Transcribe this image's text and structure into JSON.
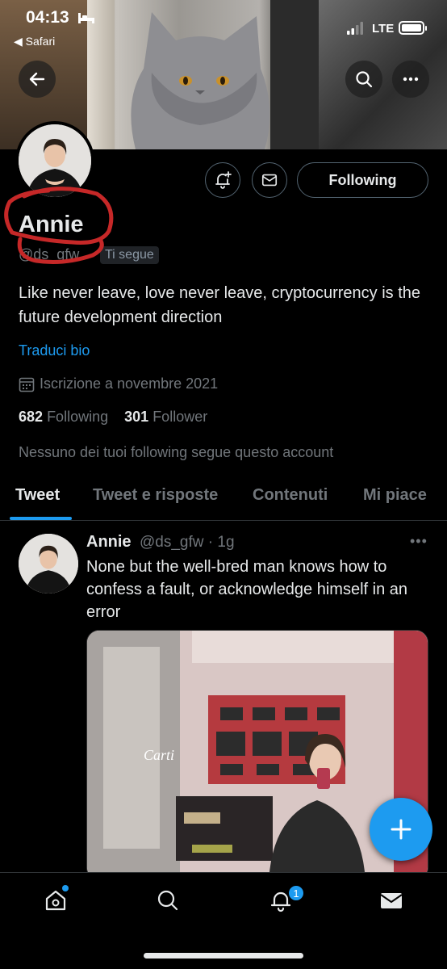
{
  "status_bar": {
    "time": "04:13",
    "back_app": "◀ Safari",
    "network": "LTE"
  },
  "profile": {
    "name": "Annie",
    "handle": "@ds_gfw",
    "follows_you": "Ti segue",
    "follow_button": "Following",
    "bio": "Like never leave, love never leave, cryptocurrency is the future development direction",
    "translate_bio": "Traduci bio",
    "joined": "Iscrizione a novembre 2021",
    "following_count": "682",
    "following_label": "Following",
    "follower_count": "301",
    "follower_label": "Follower",
    "mutuals": "Nessuno dei tuoi following segue questo account"
  },
  "tabs": [
    "Tweet",
    "Tweet e risposte",
    "Contenuti",
    "Mi piace"
  ],
  "active_tab": "Tweet",
  "tweet": {
    "name": "Annie",
    "handle_time": "@ds_gfw · 1g",
    "more": "•••",
    "text": "None but the well-bred man knows how to confess a fault, or acknowledge himself in an error",
    "media_store_sign": "Carti"
  },
  "bottom_nav": {
    "notifications_badge": "1"
  },
  "colors": {
    "accent": "#1d9bf0",
    "background": "#000000",
    "text": "#e7e9ea",
    "muted": "#71767b",
    "annotation": "#d32f2f"
  },
  "icons": [
    "back-arrow-icon",
    "search-icon",
    "more-icon",
    "bell-plus-icon",
    "mail-icon",
    "calendar-icon",
    "home-icon",
    "notifications-icon",
    "messages-icon",
    "compose-plus-icon"
  ]
}
